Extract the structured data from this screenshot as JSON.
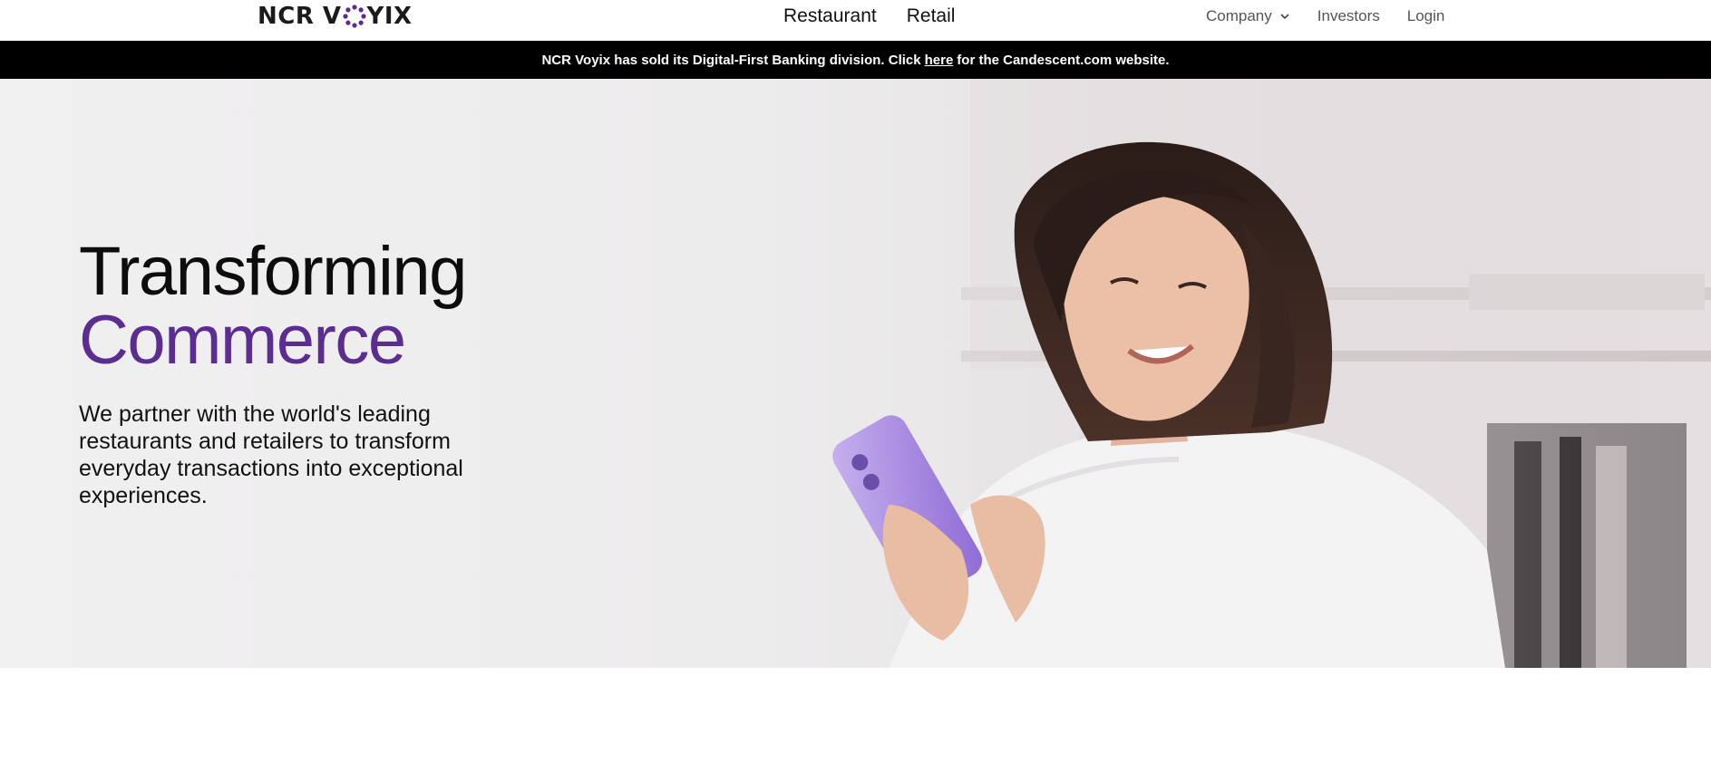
{
  "brand": {
    "logo_left": "NCR V",
    "logo_right": "YIX",
    "logo_accent": "#5b2d90"
  },
  "main_nav": {
    "items": [
      {
        "label": "Restaurant"
      },
      {
        "label": "Retail"
      }
    ]
  },
  "util_nav": {
    "company_label": "Company",
    "investors_label": "Investors",
    "login_label": "Login"
  },
  "banner": {
    "text_before": "NCR Voyix has sold its Digital-First Banking division. Click",
    "link_text": "here",
    "text_after": "for the Candescent.com website."
  },
  "hero": {
    "headline_line1": "Transforming",
    "headline_line2": "Commerce",
    "subhead": "We partner with the world's leading restaurants and retailers to transform everyday transactions into exceptional experiences.",
    "accent_color": "#5b2d90"
  },
  "icons": {
    "company_dropdown": "chevron-down-icon",
    "hero_image": "woman-with-phone-photo"
  }
}
